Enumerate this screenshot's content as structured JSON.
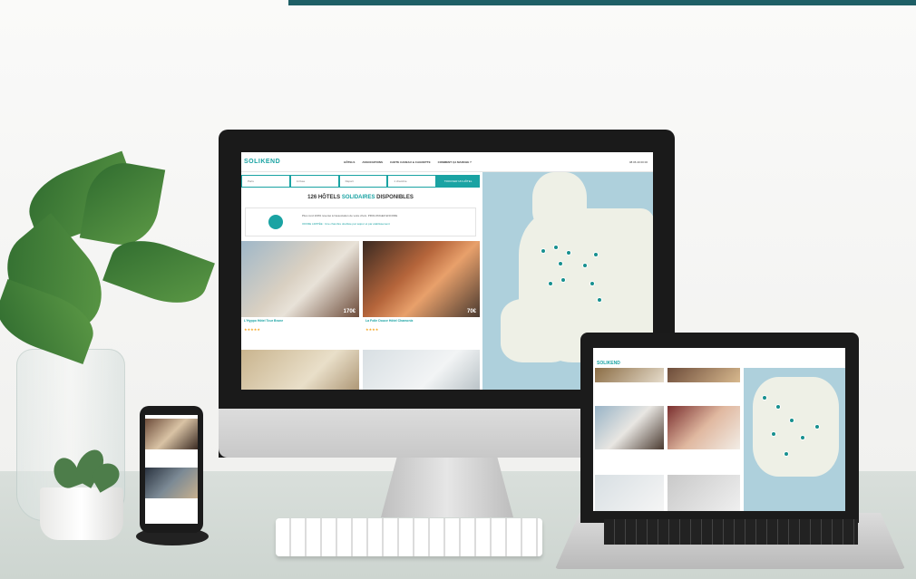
{
  "site": {
    "logo": "SOLIKEND",
    "nav": [
      "HÔTELS",
      "ASSOCIATIONS",
      "CARTE CADEAU & CAGNOTTE",
      "COMMENT ÇA MARCHE ?"
    ],
    "phone": "08 06 40 00 00",
    "search": {
      "destination_placeholder": "Paris",
      "arrival_placeholder": "Arrivée",
      "departure_placeholder": "Départ",
      "guests": "1 chambre",
      "button": "TROUVER UN HÔTEL"
    },
    "results_prefix": "126 HÔTELS",
    "results_highlight": "SOLIDAIRES",
    "results_suffix": "DISPONIBLES",
    "promo_text": "Plus rond 100% reversé à l'association de votre choix. PROLONGEZ ENCORE",
    "promo_offer": "OFFRE LIMITÉE : Une chambre doublée par séjour et par établissement",
    "hotels": [
      {
        "name": "L'Hyppo Hôtel Tour Brune",
        "price": "170€",
        "stars": "★★★★★"
      },
      {
        "name": "La Folie Douce Hôtel Chamonix",
        "price": "70€",
        "stars": "★★★★"
      }
    ]
  },
  "colors": {
    "brand": "#1aa3a3",
    "topbar": "#1e5f66",
    "map_water": "#aed0dc",
    "map_land": "#eef0e6",
    "pin": "#17908f"
  }
}
